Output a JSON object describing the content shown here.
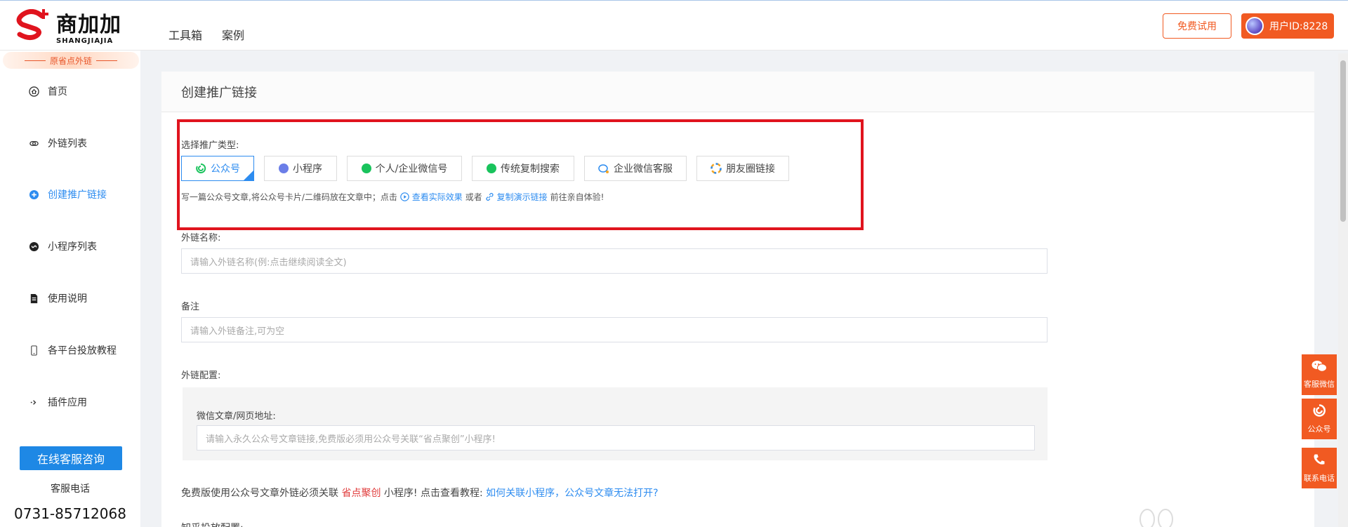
{
  "brand": {
    "name": "商加加",
    "sub": "SHANGJIAJIA"
  },
  "topnav": [
    "工具箱",
    "案例"
  ],
  "header": {
    "trial_label": "免费试用",
    "user_label": "用户ID:8228"
  },
  "sidebar": {
    "slogan": "原省点外链",
    "items": [
      {
        "label": "首页",
        "icon": "home-icon"
      },
      {
        "label": "外链列表",
        "icon": "link-icon"
      },
      {
        "label": "创建推广链接",
        "icon": "plus-circle-icon"
      },
      {
        "label": "小程序列表",
        "icon": "miniprogram-icon"
      },
      {
        "label": "使用说明",
        "icon": "document-icon"
      },
      {
        "label": "各平台投放教程",
        "icon": "phone-icon"
      },
      {
        "label": "插件应用",
        "icon": "arrow-icon"
      }
    ],
    "service_button": "在线客服咨询",
    "phone_label": "客服电话",
    "phone": "0731-85712068"
  },
  "main": {
    "title": "创建推广链接",
    "type_label": "选择推广类型:",
    "types": [
      {
        "label": "公众号",
        "color": "#19c35c",
        "selected": true
      },
      {
        "label": "小程序",
        "color": "#6b7ee8"
      },
      {
        "label": "个人/企业微信号",
        "color": "#19c35c"
      },
      {
        "label": "传统复制搜索",
        "color": "#19c35c"
      },
      {
        "label": "企业微信客服",
        "color": "#2d8cf0"
      },
      {
        "label": "朋友圈链接",
        "color": "#f5a623"
      }
    ],
    "hint": {
      "prefix": "写一篇公众号文章,将公众号卡片/二维码放在文章中；点击",
      "link1": "查看实际效果",
      "middle": "或者",
      "link2": "复制演示链接",
      "suffix": "前往亲自体验!"
    },
    "name_label": "外链名称:",
    "name_placeholder": "请输入外链名称(例:点击继续阅读全文)",
    "remark_label": "备注",
    "remark_placeholder": "请输入外链备注,可为空",
    "config_label": "外链配置:",
    "url_label": "微信文章/网页地址:",
    "url_placeholder": "请输入永久公众号文章链接,免费版必须用公众号关联“省点聚创”小程序!",
    "note": {
      "prefix": "免费版使用公众号文章外链必须关联",
      "highlight": "省点聚创",
      "middle": "小程序!  点击查看教程:",
      "link": "如何关联小程序，公众号文章无法打开?"
    },
    "cut_label": "知乎投放配置:"
  },
  "float_panel": [
    {
      "label": "客服微信",
      "icon": "wechat-icon"
    },
    {
      "label": "公众号",
      "icon": "official-account-icon"
    },
    {
      "label": "联系电话",
      "icon": "phone-call-icon"
    }
  ],
  "colors": {
    "accent": "#f15a22",
    "link": "#2d8cf0",
    "highlight_box": "#e0141e"
  }
}
